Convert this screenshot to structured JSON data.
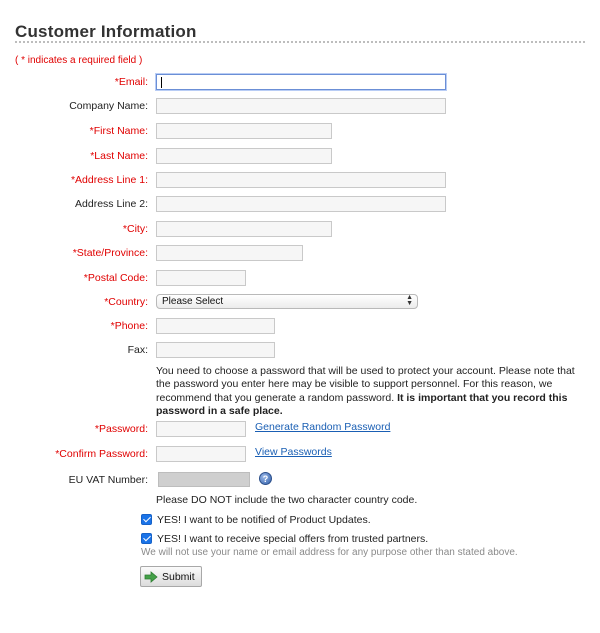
{
  "page_title": "Customer Information",
  "required_note": "( * indicates a required field )",
  "fields": {
    "email": {
      "label": "*Email:",
      "value": ""
    },
    "company": {
      "label": "Company Name:",
      "value": ""
    },
    "first_name": {
      "label": "*First Name:",
      "value": ""
    },
    "last_name": {
      "label": "*Last Name:",
      "value": ""
    },
    "address1": {
      "label": "*Address Line 1:",
      "value": ""
    },
    "address2": {
      "label": "Address Line 2:",
      "value": ""
    },
    "city": {
      "label": "*City:",
      "value": ""
    },
    "state": {
      "label": "*State/Province:",
      "value": ""
    },
    "postal": {
      "label": "*Postal Code:",
      "value": ""
    },
    "country": {
      "label": "*Country:",
      "selected": "Please Select"
    },
    "phone": {
      "label": "*Phone:",
      "value": ""
    },
    "fax": {
      "label": "Fax:",
      "value": ""
    },
    "password": {
      "label": "*Password:",
      "value": ""
    },
    "confirm_password": {
      "label": "*Confirm Password:",
      "value": ""
    },
    "vat": {
      "label": "EU VAT Number:",
      "value": ""
    }
  },
  "password_info": {
    "text": "You need to choose a password that will be used to protect your account. Please note that the password you enter here may be visible to support personnel. For this reason, we recommend that you generate a random password.",
    "bold": "It is important that you record this password in a safe place."
  },
  "links": {
    "generate_password": "Generate Random Password",
    "view_passwords": "View Passwords"
  },
  "vat_note": "Please DO NOT include the two character country code.",
  "checkboxes": {
    "product_updates": {
      "label": "YES! I want to be notified of Product Updates.",
      "checked": true
    },
    "partner_offers": {
      "label": "YES! I want to receive special offers from trusted partners.",
      "checked": true
    }
  },
  "disclaimer": "We will not use your name or email address for any purpose other than stated above.",
  "submit_label": "Submit",
  "colors": {
    "required": "#e00000",
    "link": "#1a5fb4",
    "checkbox": "#1a73e8"
  }
}
